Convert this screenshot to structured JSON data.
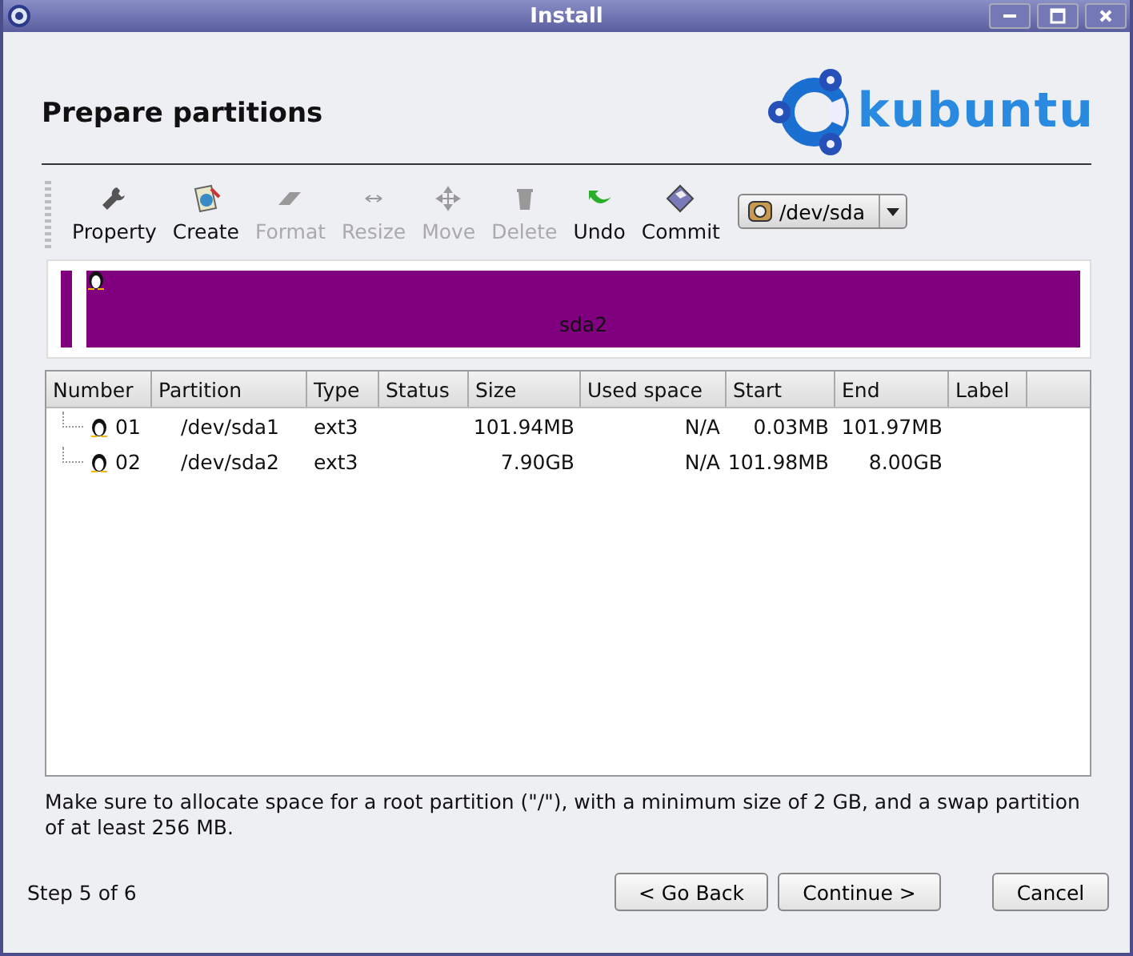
{
  "window": {
    "title": "Install"
  },
  "header": {
    "title": "Prepare partitions",
    "logo_text": "kubuntu"
  },
  "toolbar": [
    {
      "label": "Property",
      "disabled": false
    },
    {
      "label": "Create",
      "disabled": false
    },
    {
      "label": "Format",
      "disabled": true
    },
    {
      "label": "Resize",
      "disabled": true
    },
    {
      "label": "Move",
      "disabled": true
    },
    {
      "label": "Delete",
      "disabled": true
    },
    {
      "label": "Undo",
      "disabled": false
    },
    {
      "label": "Commit",
      "disabled": false
    }
  ],
  "device": {
    "value": "/dev/sda"
  },
  "partition_bar": {
    "label": "sda2"
  },
  "table": {
    "columns": [
      "Number",
      "Partition",
      "Type",
      "Status",
      "Size",
      "Used space",
      "Start",
      "End",
      "Label"
    ],
    "rows": [
      {
        "cells": [
          "01",
          "/dev/sda1",
          "ext3",
          "",
          "101.94MB",
          "N/A",
          "0.03MB",
          "101.97MB",
          ""
        ]
      },
      {
        "cells": [
          "02",
          "/dev/sda2",
          "ext3",
          "",
          "7.90GB",
          "N/A",
          "101.98MB",
          "8.00GB",
          ""
        ]
      }
    ]
  },
  "note": "Make sure to allocate space for a root partition (\"/\"), with a minimum size of 2 GB, and a swap partition of at least 256 MB.",
  "footer": {
    "step": "Step 5 of 6",
    "buttons": [
      "< Go Back",
      "Continue >",
      "Cancel"
    ]
  }
}
